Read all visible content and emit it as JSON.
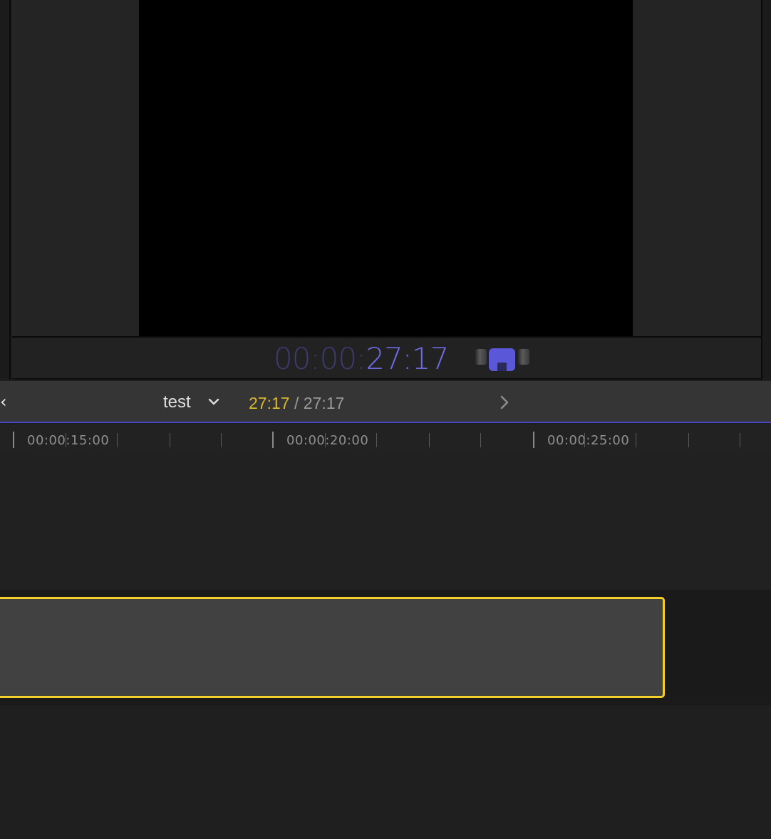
{
  "viewer": {
    "timecode_dim": "00:00:",
    "timecode_bright": "27:17"
  },
  "timeline": {
    "back_glyph": "‹",
    "project_name": "test",
    "current_time": "27:17",
    "separator": "/",
    "total_time": "27:17"
  },
  "ruler": {
    "labels": [
      "00:00:15:00",
      "00:00:20:00",
      "00:00:25:00"
    ]
  },
  "icons": {
    "back": "chevron-left-icon",
    "project_menu": "chevron-down-icon",
    "forward": "chevron-right-icon",
    "skimmer": "skimming-toggle-icon"
  },
  "colors": {
    "timecode_accent": "#6e6ae0",
    "playhead_line": "#4b47c4",
    "current_time": "#d9b92d",
    "clip_selection": "#f3cf2a"
  }
}
